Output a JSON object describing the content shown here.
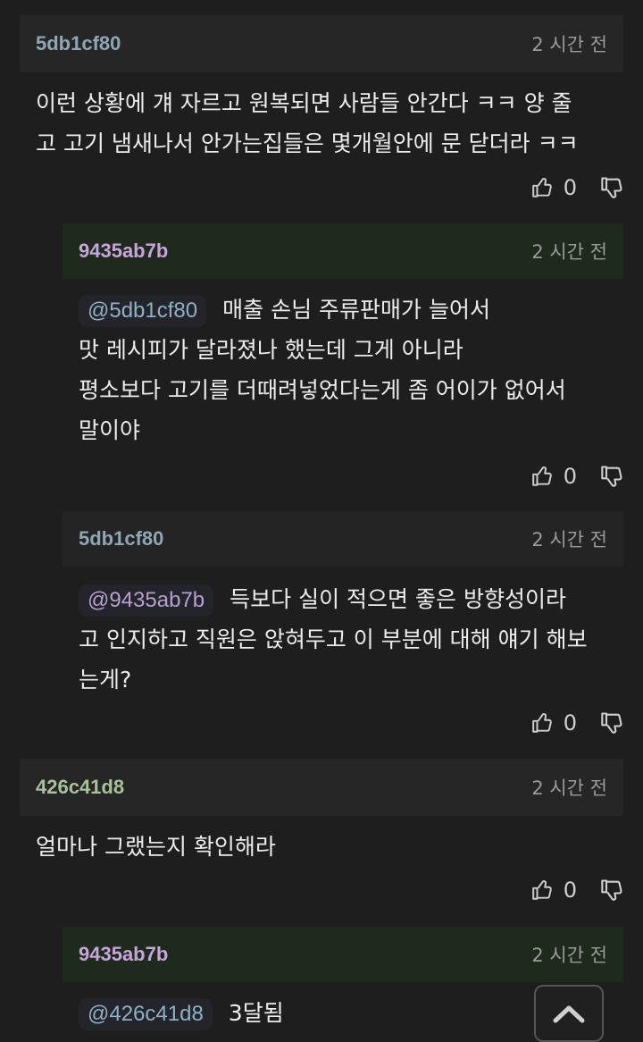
{
  "colors": {
    "author_teal": "#8fa7b3",
    "author_purple": "#c8a4dc",
    "author_olive": "#a9c19a",
    "mention_purple": "#b79fd0",
    "mention_teal": "#8fb0c6"
  },
  "comments": [
    {
      "author": "5db1cf80",
      "time": "2 시간 전",
      "lines": [
        "이런 상황에 걔 자르고 원복되면 사람들 안간다 ㅋㅋ 양 줄",
        "고 고기 냄새나서 안가는집들은 몇개월안에 문 닫더라 ㅋㅋ"
      ],
      "likes": "0"
    },
    {
      "author": "9435ab7b",
      "time": "2 시간 전",
      "mention": "@5db1cf80",
      "lines": [
        "매출 손님 주류판매가 늘어서",
        "맛 레시피가 달라졌나 했는데 그게 아니라",
        "평소보다 고기를 더때려넣었다는게 좀 어이가 없어서",
        "말이야"
      ],
      "likes": "0"
    },
    {
      "author": "5db1cf80",
      "time": "2 시간 전",
      "mention": "@9435ab7b",
      "lines": [
        "득보다 실이 적으면 좋은 방향성이라",
        "고 인지하고 직원은 앉혀두고 이 부분에 대해 얘기 해보",
        "는게?"
      ],
      "likes": "0"
    },
    {
      "author": "426c41d8",
      "time": "2 시간 전",
      "lines": [
        "얼마나 그랬는지 확인해라"
      ],
      "likes": "0"
    },
    {
      "author": "9435ab7b",
      "time": "2 시간 전",
      "mention": "@426c41d8",
      "lines": [
        "3달됨"
      ]
    }
  ],
  "icons": {
    "like": "thumbs-up-icon",
    "dislike": "thumbs-down-icon",
    "scroll_top": "chevron-up-icon"
  }
}
